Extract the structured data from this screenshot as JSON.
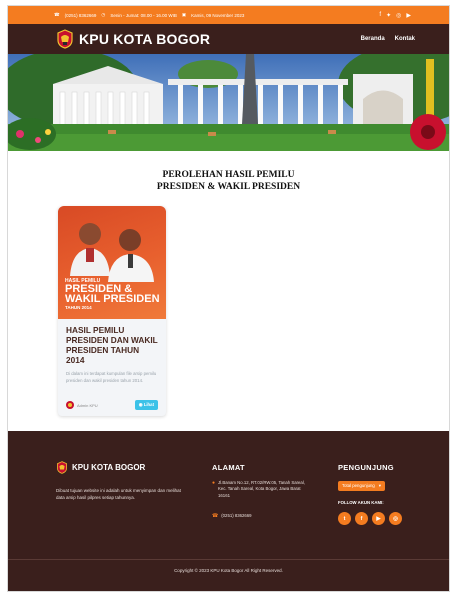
{
  "topbar": {
    "phone": "(0251) 8362669",
    "hours": "Senin - Jumat: 08.00 - 16.00 WIB",
    "date": "Kamis, 09 November 2023",
    "social_icons": [
      "facebook-icon",
      "twitter-icon",
      "instagram-icon",
      "youtube-icon"
    ]
  },
  "header": {
    "brand": "KPU KOTA BOGOR",
    "nav": [
      "Beranda",
      "Kontak"
    ]
  },
  "main": {
    "title_line1": "PEROLEHAN HASIL PEMILU",
    "title_line2": "PRESIDEN & WAKIL PRESIDEN",
    "card": {
      "thumb_small": "HASIL PEMILU",
      "thumb_big1": "PRESIDEN &",
      "thumb_big2": "WAKIL PRESIDEN",
      "thumb_year": "TAHUN 2014",
      "title": "HASIL PEMILU PRESIDEN DAN WAKIL PRESIDEN TAHUN 2014",
      "desc": "Di dalam ini terdapat kumpulan file arsip pemilu presiden dan wakil presiden tahun 2014.",
      "author": "Admin KPU",
      "button": "Lihat"
    }
  },
  "footer": {
    "brand": "KPU KOTA BOGOR",
    "desc": "Dibuat tujuan website ini adalah untuk menyimpan dan melihat data arsip hasil pilpres setiap tahunnya.",
    "alamat_heading": "ALAMAT",
    "address": "Jl.Banam No.12, RT.02/RW.05, Tanah Sareal, Kec. Tanah Sareal, Kota Bogor, Jawa Barat 16161",
    "phone": "(0251) 8362669",
    "pengunjung_heading": "PENGUNJUNG",
    "select": "Total pengunjung",
    "follow": "FOLLOW AKUN KAMI:",
    "copyright": "Copyright © 2023 KPU Kota Bogor All Right Reserved."
  },
  "colors": {
    "accent": "#f47c20",
    "dark": "#3a1f1c"
  }
}
